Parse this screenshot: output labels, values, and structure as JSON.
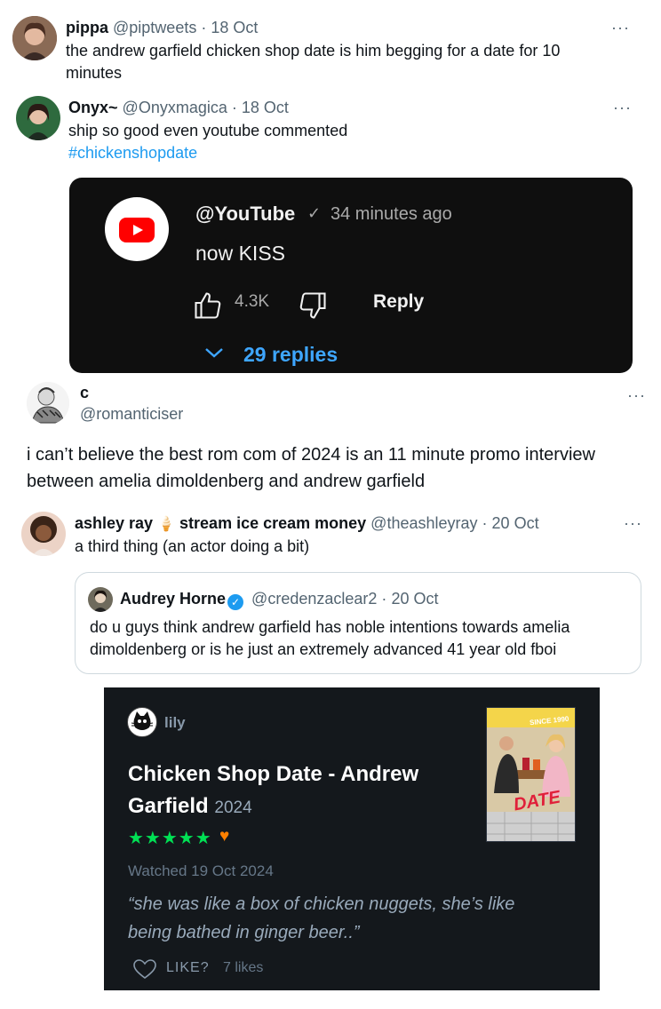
{
  "tweet1": {
    "display_name": "pippa",
    "handle": "@piptweets",
    "separator": "·",
    "date": "18 Oct",
    "text_line1": "the andrew garfield chicken shop date is him begging for a date for 10",
    "text_line2": "minutes"
  },
  "tweet2": {
    "display_name": "Onyx~",
    "handle": "@Onyxmagica",
    "separator": "·",
    "date": "18 Oct",
    "text": "ship so good even youtube commented",
    "hashtag": "#chickenshopdate",
    "youtube_comment": {
      "handle": "@YouTube",
      "check": "✓",
      "time": "34 minutes ago",
      "comment": "now KISS",
      "likes": "4.3K",
      "reply_label": "Reply",
      "replies": "29 replies"
    }
  },
  "tweet3": {
    "display_name": "c",
    "handle": "@romanticiser",
    "text_line1": "i can’t believe the best rom com of 2024 is an 11 minute promo interview",
    "text_line2": "between amelia dimoldenberg and andrew garfield"
  },
  "tweet4": {
    "display_name": "ashley ray",
    "emoji": "🍦",
    "display_name_suffix": "stream ice cream money",
    "handle": "@theashleyray",
    "separator": "·",
    "date": "20 Oct",
    "text": "a third thing (an actor doing a bit)",
    "quote": {
      "display_name": "Audrey Horne",
      "verified_mark": "✓",
      "handle": "@credenzaclear2",
      "separator": "·",
      "date": "20 Oct",
      "text_line1": "do u guys think andrew garfield has noble intentions towards amelia",
      "text_line2": "dimoldenberg or is he just an extremely advanced 41 year old fboi"
    }
  },
  "letterboxd": {
    "username": "lily",
    "title": "Chicken Shop Date - Andrew Garfield",
    "year": "2024",
    "stars": "★★★★★",
    "heart": "♥",
    "watched": "Watched 19 Oct 2024",
    "review_line1": "“she was like a box of chicken nuggets, she’s like",
    "review_line2": "being bathed in ginger beer..”",
    "like_label": "LIKE?",
    "likes": "7 likes",
    "poster_since": "SINCE 1990",
    "poster_date": "DATE"
  },
  "more_icon": "···",
  "colors": {
    "twitter_blue": "#1d9bf0",
    "youtube_red": "#ff0000",
    "youtube_link": "#3ea6ff",
    "letterboxd_green": "#00e054",
    "letterboxd_orange": "#ff8000",
    "letterboxd_bg": "#14181c"
  }
}
